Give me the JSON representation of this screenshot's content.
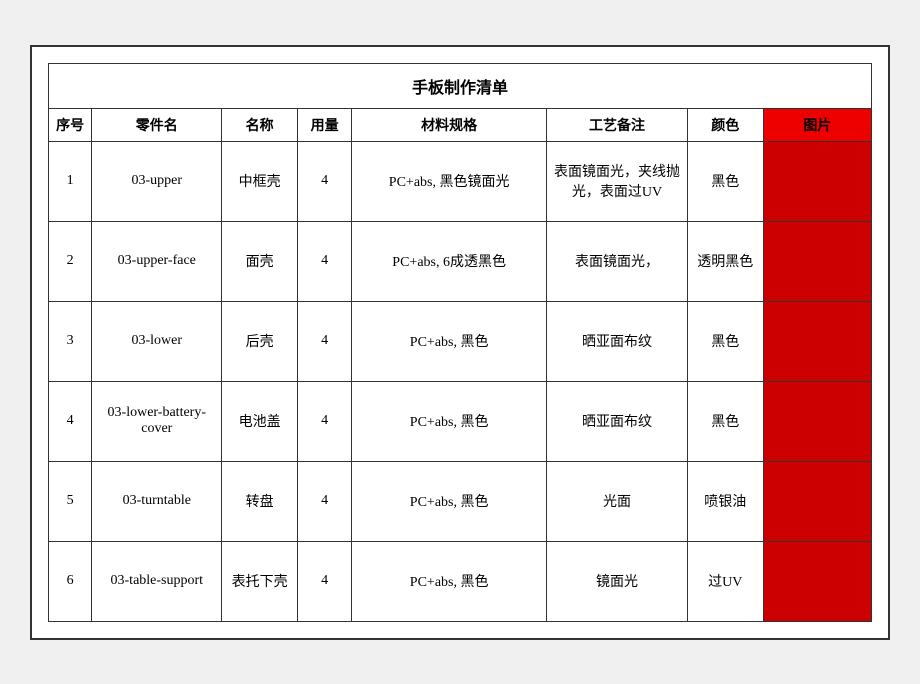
{
  "title": "手板制作清单",
  "headers": {
    "seq": "序号",
    "part": "零件名",
    "name": "名称",
    "qty": "用量",
    "spec": "材料规格",
    "process": "工艺备注",
    "color": "颜色",
    "pic": "图片"
  },
  "rows": [
    {
      "seq": "1",
      "part": "03-upper",
      "name": "中框壳",
      "qty": "4",
      "spec": "PC+abs, 黑色镜面光",
      "process": "表面镜面光，夹线抛光，表面过UV",
      "color": "黑色"
    },
    {
      "seq": "2",
      "part": "03-upper-face",
      "name": "面壳",
      "qty": "4",
      "spec": "PC+abs, 6成透黑色",
      "process": "表面镜面光，",
      "color": "透明黑色"
    },
    {
      "seq": "3",
      "part": "03-lower",
      "name": "后壳",
      "qty": "4",
      "spec": "PC+abs, 黑色",
      "process": "晒亚面布纹",
      "color": "黑色"
    },
    {
      "seq": "4",
      "part": "03-lower-battery-cover",
      "name": "电池盖",
      "qty": "4",
      "spec": "PC+abs, 黑色",
      "process": "晒亚面布纹",
      "color": "黑色"
    },
    {
      "seq": "5",
      "part": "03-turntable",
      "name": "转盘",
      "qty": "4",
      "spec": "PC+abs, 黑色",
      "process": "光面",
      "color": "喷银油"
    },
    {
      "seq": "6",
      "part": "03-table-support",
      "name": "表托下壳",
      "qty": "4",
      "spec": "PC+abs, 黑色",
      "process": "镜面光",
      "color": "过UV"
    }
  ]
}
